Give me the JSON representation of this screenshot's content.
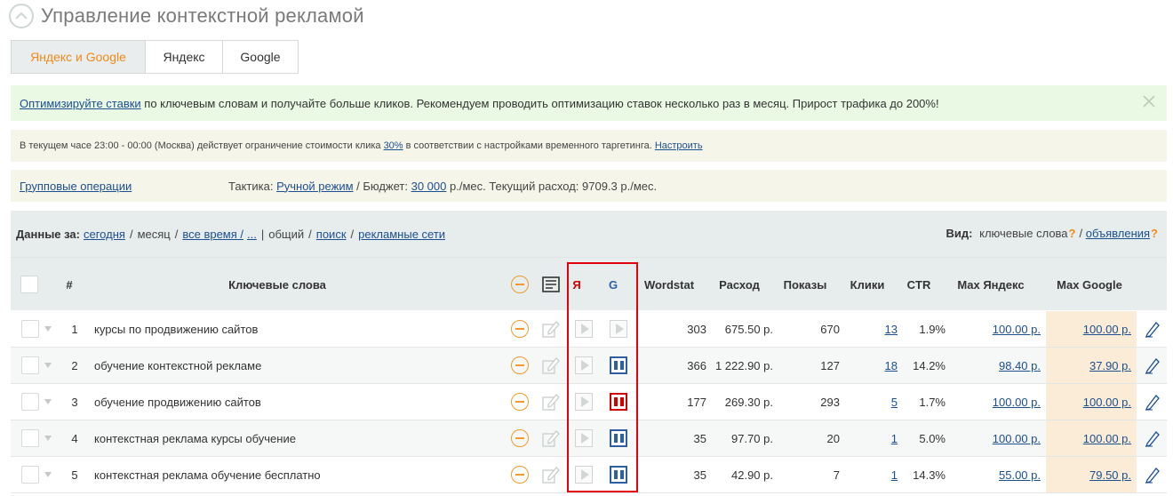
{
  "header": {
    "title": "Управление контекстной рекламой"
  },
  "tabs": [
    {
      "label": "Яндекс и Google",
      "active": true
    },
    {
      "label": "Яндекс",
      "active": false
    },
    {
      "label": "Google",
      "active": false
    }
  ],
  "optimize_banner": {
    "link": "Оптимизируйте ставки",
    "text": " по ключевым словам и получайте больше кликов. Рекомендуем проводить оптимизацию ставок несколько раз в месяц. Прирост трафика до 200%!"
  },
  "info_banner": {
    "text_before": "В текущем часе 23:00 - 00:00 (Москва) действует ограничение стоимости клика ",
    "percent": "30%",
    "text_after": " в соответствии с настройками временного таргетинга. ",
    "settings_link": "Настроить"
  },
  "ops_bar": {
    "group_ops": "Групповые операции",
    "tactic_label": "Тактика: ",
    "tactic_value": "Ручной режим",
    "budget_label": " / Бюджет: ",
    "budget_value": "30 000",
    "budget_suffix": " р./мес. Текущий расход: 9709.3 р./мес."
  },
  "filter": {
    "label": "Данные за:",
    "today": "сегодня",
    "month": "месяц",
    "all_time": "все время /",
    "ellipsis": "...",
    "total": "общий",
    "search": "поиск",
    "networks": "рекламные сети",
    "view_label": "Вид:",
    "view_keywords": "ключевые слова",
    "view_ads": "объявления"
  },
  "columns": {
    "num": "#",
    "keywords": "Ключевые слова",
    "ya": "Я",
    "g": "G",
    "wordstat": "Wordstat",
    "spend": "Расход",
    "impressions": "Показы",
    "clicks": "Клики",
    "ctr": "CTR",
    "max_yandex": "Max Яндекс",
    "max_google": "Max Google"
  },
  "rows": [
    {
      "num": "1",
      "keyword": "курсы по продвижению сайтов",
      "ya_state": "play",
      "g_state": "play",
      "wordstat": "303",
      "spend": "675.50 р.",
      "impressions": "670",
      "clicks": "13",
      "ctr": "1.9%",
      "max_yandex": "100.00 р.",
      "max_google": "100.00 р."
    },
    {
      "num": "2",
      "keyword": "обучение контекстной рекламе",
      "ya_state": "play",
      "g_state": "pause",
      "wordstat": "366",
      "spend": "1 222.90 р.",
      "impressions": "127",
      "clicks": "18",
      "ctr": "14.2%",
      "max_yandex": "98.40 р.",
      "max_google": "37.90 р."
    },
    {
      "num": "3",
      "keyword": "обучение продвижению сайтов",
      "ya_state": "play",
      "g_state": "pause-red",
      "wordstat": "177",
      "spend": "269.30 р.",
      "impressions": "293",
      "clicks": "5",
      "ctr": "1.7%",
      "max_yandex": "100.00 р.",
      "max_google": "100.00 р."
    },
    {
      "num": "4",
      "keyword": "контекстная реклама курсы обучение",
      "ya_state": "play",
      "g_state": "pause",
      "wordstat": "35",
      "spend": "97.70 р.",
      "impressions": "20",
      "clicks": "1",
      "ctr": "5.0%",
      "max_yandex": "100.00 р.",
      "max_google": "100.00 р."
    },
    {
      "num": "5",
      "keyword": "контекстная реклама обучение бесплатно",
      "ya_state": "play",
      "g_state": "pause",
      "wordstat": "35",
      "spend": "42.90 р.",
      "impressions": "7",
      "clicks": "1",
      "ctr": "14.3%",
      "max_yandex": "55.00 р.",
      "max_google": "79.50 р."
    }
  ],
  "colors": {
    "accent": "#f08a1c",
    "link": "#1c4f8f",
    "yandex_red": "#d40000",
    "google_blue": "#2d5fa3",
    "highlight": "#e3000f"
  }
}
